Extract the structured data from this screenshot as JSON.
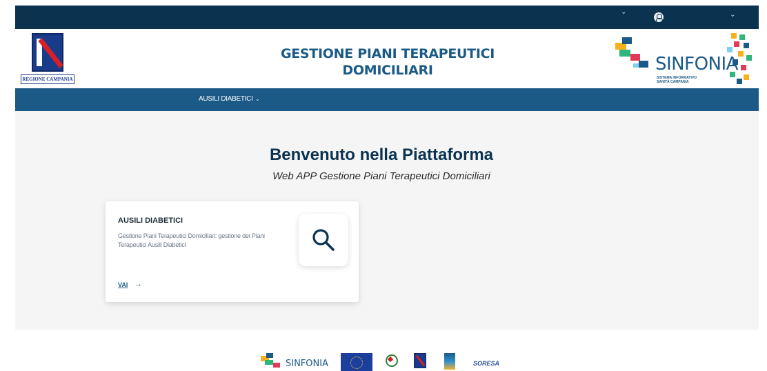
{
  "topbar": {
    "icons": [
      "chevron-down-icon",
      "user-icon",
      "chevron-down-icon"
    ]
  },
  "header": {
    "region_logo_label": "REGIONE CAMPANIA",
    "title_line1": "GESTIONE PIANI TERAPEUTICI",
    "title_line2": "DOMICILIARI",
    "sinfonia_name": "SINFONIA",
    "sinfonia_sub1": "SISTEMA INFORMATIVO",
    "sinfonia_sub2": "SANITÀ CAMPANIA"
  },
  "nav": {
    "items": [
      {
        "label": "AUSILI DIABETICI",
        "icon": "chevron-down-icon"
      }
    ]
  },
  "main": {
    "welcome": "Benvenuto nella Piattaforma",
    "subtitle": "Web APP Gestione Piani Terapeutici Domiciliari",
    "card": {
      "title": "AUSILI DIABETICI",
      "description": "Gestione Piani Terapeutici Domiciliari: gestione dei Piani Terapeutici Ausili Diabetici",
      "link_label": "VAI",
      "link_arrow": "→",
      "icon": "search-icon"
    }
  },
  "footer": {
    "sinfonia_name": "SINFONIA",
    "soresa_name": "SORESA",
    "logos": [
      "sinfonia-logo",
      "eu-flag-logo",
      "repubblica-emblem",
      "regione-campania-logo",
      "fesr-logo",
      "soresa-logo"
    ]
  },
  "colors": {
    "topbar": "#0b3350",
    "primary": "#1b5a86",
    "background": "#f5f5f5"
  }
}
